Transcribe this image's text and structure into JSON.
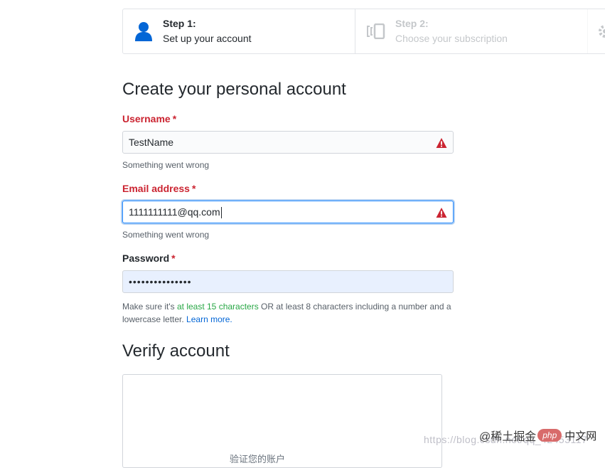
{
  "steps": [
    {
      "number": "Step 1:",
      "description": "Set up your account",
      "icon": "person-icon"
    },
    {
      "number": "Step 2:",
      "description": "Choose your subscription",
      "icon": "devices-icon"
    },
    {
      "icon": "gear-icon"
    }
  ],
  "form": {
    "heading": "Create your personal account",
    "username": {
      "label": "Username",
      "required": "*",
      "value": "TestName",
      "error": "Something went wrong"
    },
    "email": {
      "label": "Email address",
      "required": "*",
      "value": "1111111111@qq.com",
      "error": "Something went wrong"
    },
    "password": {
      "label": "Password",
      "required": "*",
      "value": "•••••••••••••••"
    },
    "hint": {
      "before": "Make sure it's ",
      "green": "at least 15 characters",
      "middle": " OR at least 8 characters including a number and a lowercase letter. ",
      "link": "Learn more."
    }
  },
  "verify": {
    "heading": "Verify account",
    "box_text": "验证您的账户"
  },
  "watermark": {
    "url": "https://blog.csdn.net/qq_42453117",
    "at": "@稀土掘金",
    "badge": "php",
    "cn": "中文网"
  },
  "colors": {
    "error": "#cb2431",
    "focus": "#2188ff",
    "accent_blue": "#0366d6",
    "green": "#28a745",
    "autofill_bg": "#e8f0fe"
  }
}
